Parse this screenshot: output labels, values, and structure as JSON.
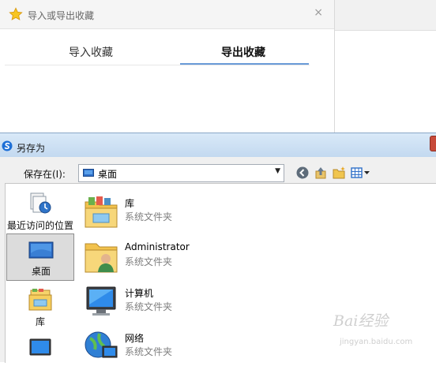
{
  "favorites_dialog": {
    "title": "导入或导出收藏",
    "star_icon": "star-icon",
    "close_glyph": "×",
    "tabs": [
      {
        "label": "导入收藏",
        "active": false
      },
      {
        "label": "导出收藏",
        "active": true
      }
    ],
    "accent_color": "#6a9bd8"
  },
  "save_dialog": {
    "title": "另存为",
    "save_in_label": "保存在(I):",
    "location": {
      "icon": "desktop-icon",
      "value": "桌面"
    },
    "toolbar": [
      "back-icon",
      "up-folder-icon",
      "new-folder-icon",
      "view-menu-icon"
    ],
    "places": [
      {
        "label": "最近访问的位置",
        "icon": "recent-places-icon",
        "selected": false
      },
      {
        "label": "桌面",
        "icon": "desktop-icon",
        "selected": true
      },
      {
        "label": "库",
        "icon": "library-icon",
        "selected": false
      },
      {
        "label": "",
        "icon": "computer-icon",
        "selected": false
      }
    ],
    "files": [
      {
        "name": "库",
        "type": "系统文件夹",
        "icon": "library-folder-icon"
      },
      {
        "name": "Administrator",
        "type": "系统文件夹",
        "icon": "user-folder-icon"
      },
      {
        "name": "计算机",
        "type": "系统文件夹",
        "icon": "computer-icon"
      },
      {
        "name": "网络",
        "type": "系统文件夹",
        "icon": "network-icon"
      }
    ]
  },
  "watermark": {
    "text": "Bai经验",
    "url": "jingyan.baidu.com"
  }
}
